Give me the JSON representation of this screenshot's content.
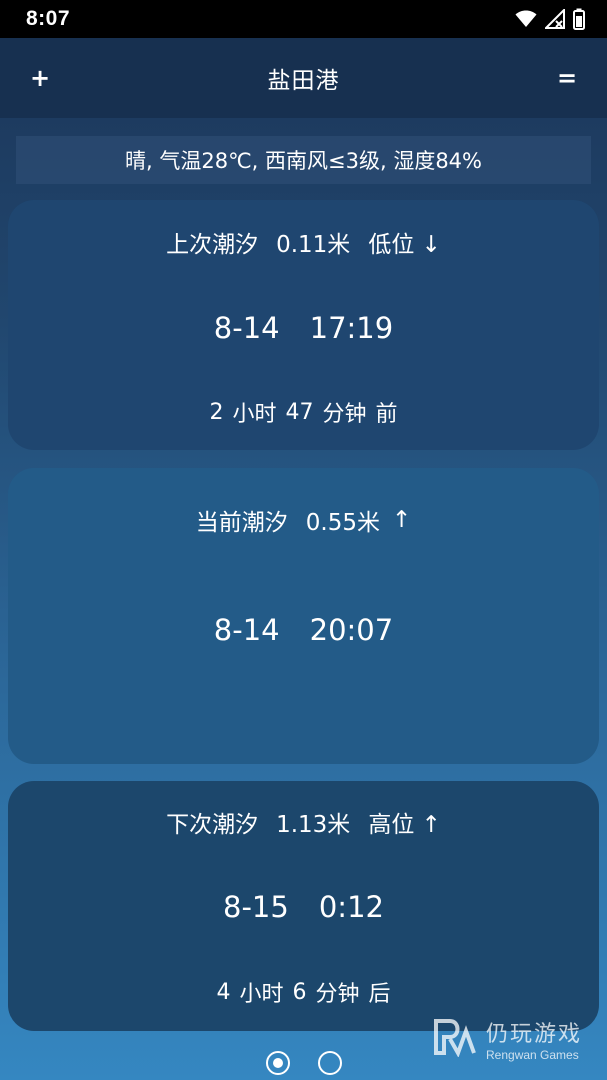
{
  "status_bar": {
    "time": "8:07",
    "icons": [
      "wifi-icon",
      "signal-no-sim-icon",
      "battery-icon"
    ]
  },
  "app_bar": {
    "add_label": "+",
    "title": "盐田港",
    "menu_label": "="
  },
  "weather": {
    "text": "晴, 气温28℃, 西南风≤3级, 湿度84%"
  },
  "tides": {
    "previous": {
      "label": "上次潮汐",
      "height": "0.11米",
      "level": "低位 ↓",
      "date": "8-14",
      "time": "17:19",
      "relative": [
        "2",
        "小时",
        "47",
        "分钟",
        "前"
      ]
    },
    "current": {
      "label": "当前潮汐",
      "height": "0.55米",
      "trend": "↑",
      "date": "8-14",
      "time": "20:07"
    },
    "next": {
      "label": "下次潮汐",
      "height": "1.13米",
      "level": "高位 ↑",
      "date": "8-15",
      "time": "0:12",
      "relative": [
        "4",
        "小时",
        "6",
        "分钟",
        "后"
      ]
    }
  },
  "pager": {
    "pages": 2,
    "active": 1
  },
  "watermark": {
    "cn": "仍玩游戏",
    "en": "Rengwan Games"
  },
  "colors": {
    "status_bar": "#000000",
    "app_bar": "#173050",
    "card_previous": "#1f4670",
    "card_current": "#235b88",
    "card_next": "#1c476c",
    "background_top": "#1b3457",
    "background_bottom": "#3587c1"
  }
}
